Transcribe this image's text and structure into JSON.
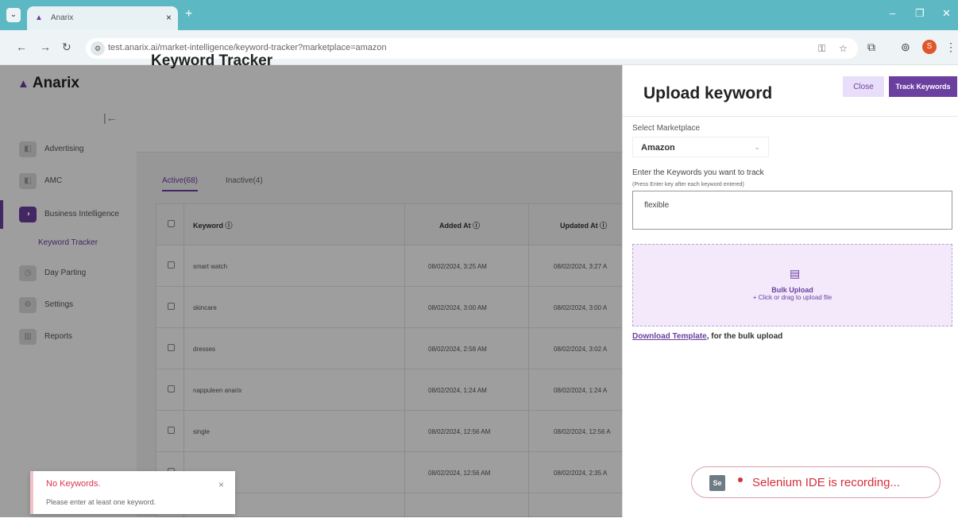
{
  "browser": {
    "tab_title": "Anarix",
    "tab_close": "×",
    "new_tab": "+",
    "url": "test.anarix.ai/market-intelligence/keyword-tracker?marketplace=amazon",
    "profile_initial": "S"
  },
  "app": {
    "logo": "Anarix",
    "page_title": "Keyword Tracker",
    "sidebar": {
      "items": [
        {
          "label": "Advertising"
        },
        {
          "label": "AMC"
        },
        {
          "label": "Business Intelligence"
        },
        {
          "label": "Day Parting"
        },
        {
          "label": "Settings"
        },
        {
          "label": "Reports"
        }
      ],
      "sub_item": "Keyword Tracker"
    },
    "tabs": [
      {
        "label": "Active(68)"
      },
      {
        "label": "Inactive(4)"
      }
    ],
    "table": {
      "headers": [
        "Keyword ⓘ",
        "Added At ⓘ",
        "Updated At ⓘ"
      ],
      "rows": [
        {
          "keyword": "smart watch",
          "added": "08/02/2024, 3:25 AM",
          "updated": "08/02/2024, 3:27 A"
        },
        {
          "keyword": "skincare",
          "added": "08/02/2024, 3:00 AM",
          "updated": "08/02/2024, 3:00 A"
        },
        {
          "keyword": "dresses",
          "added": "08/02/2024, 2:58 AM",
          "updated": "08/02/2024, 3:02 A"
        },
        {
          "keyword": "nappuleen anarix",
          "added": "08/02/2024, 1:24 AM",
          "updated": "08/02/2024, 1:24 A"
        },
        {
          "keyword": "single",
          "added": "08/02/2024, 12:56 AM",
          "updated": "08/02/2024, 12:56 A"
        },
        {
          "keyword": "",
          "added": "08/02/2024, 12:56 AM",
          "updated": "08/02/2024, 2:35 A"
        }
      ]
    }
  },
  "toast": {
    "title": "No Keywords.",
    "message": "Please enter at least one keyword.",
    "close": "×"
  },
  "drawer": {
    "title": "Upload keyword",
    "close_label": "Close",
    "track_label": "Track Keywords",
    "marketplace_label": "Select Marketplace",
    "marketplace_value": "Amazon",
    "keywords_label": "Enter the Keywords you want to track",
    "keywords_hint": "(Press Enter key after each keyword entered)",
    "keywords_value": "flexible",
    "bulk_upload_title": "Bulk Upload",
    "bulk_upload_sub": "+ Click or drag to upload file",
    "download_link": "Download Template",
    "download_suffix": ", for the bulk upload"
  },
  "selenium": {
    "icon": "Se",
    "text": "Selenium IDE is recording..."
  },
  "colors": {
    "accent": "#6b3fa0",
    "tabbar": "#5cb8c2",
    "error": "#d52f3b"
  }
}
